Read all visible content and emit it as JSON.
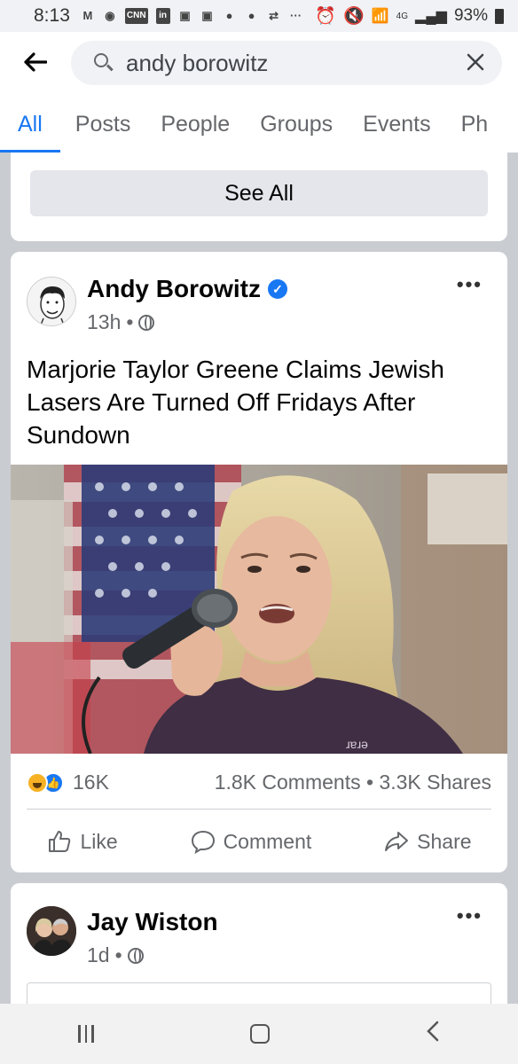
{
  "status_bar": {
    "time": "8:13",
    "battery": "93%",
    "network": "4G"
  },
  "search": {
    "query": "andy borowitz"
  },
  "tabs": [
    "All",
    "Posts",
    "People",
    "Groups",
    "Events",
    "Ph"
  ],
  "see_all_label": "See All",
  "post1": {
    "author": "Andy Borowitz",
    "time": "13h",
    "text": "Marjorie Taylor Greene Claims Jewish Lasers Are Turned Off Fridays After Sundown",
    "reactions_count": "16K",
    "comments_shares": "1.8K Comments • 3.3K Shares",
    "actions": {
      "like": "Like",
      "comment": "Comment",
      "share": "Share"
    }
  },
  "post2": {
    "author": "Jay Wiston",
    "time": "1d"
  },
  "colors": {
    "accent": "#1877f2",
    "secondary_text": "#65676b",
    "feed_bg": "#c9ccd1"
  }
}
